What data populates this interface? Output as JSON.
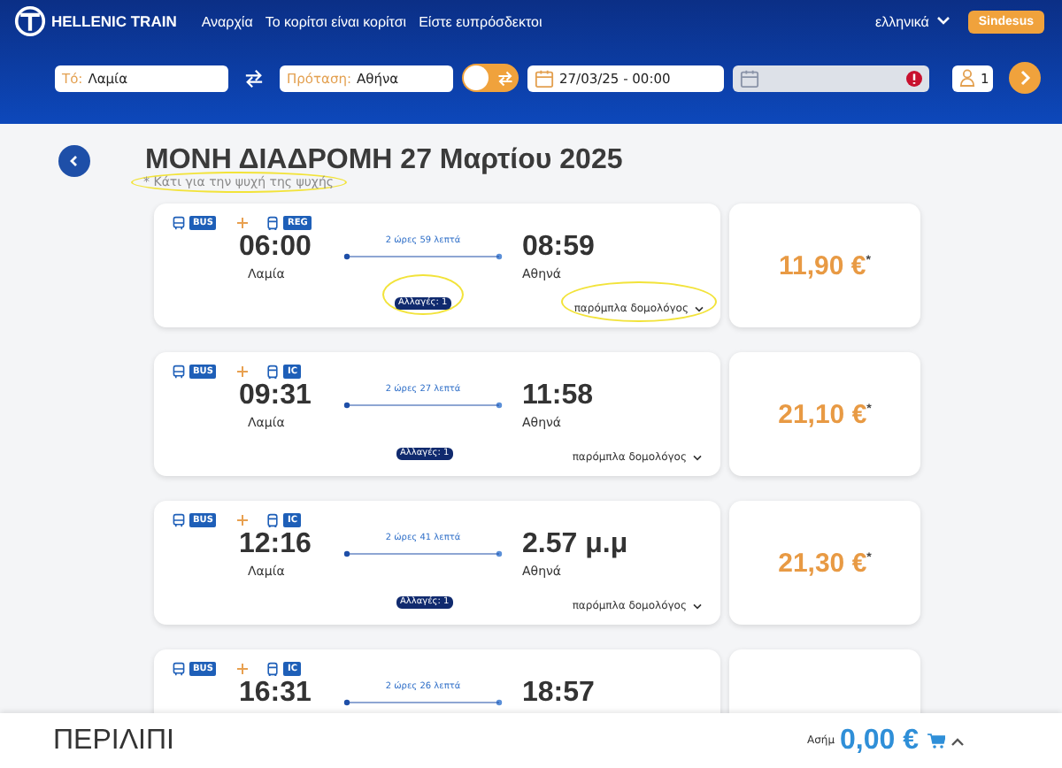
{
  "header": {
    "logo_text": "HELLENIC TRAIN",
    "nav": [
      "Αναρχία",
      "Το κορίτσι είναι κορίτσι",
      "Είστε ευπρόσδεκτοι"
    ],
    "language": "ελληνικά",
    "login_button": "Sindesus"
  },
  "search": {
    "from": {
      "label": "Τό:",
      "value": "Λαμία"
    },
    "to": {
      "label": "Πρόταση:",
      "value": "Αθήνα"
    },
    "round_trip_toggle": {
      "on": false
    },
    "date": {
      "value": "27/03/25 - 00:00"
    },
    "return_date": {
      "disabled": true,
      "error": true
    },
    "passengers": {
      "value": "1"
    }
  },
  "title": "ΜΟΝΗ ΔΙΑΔΡΟΜΗ 27 Μαρτίου 2025",
  "note": {
    "text": "* Κάτι για την ψυχή της ψυχής",
    "highlighted": true
  },
  "journeys": [
    {
      "legs": [
        "BUS",
        "REG"
      ],
      "depart": "06:00",
      "from": "Λαμία",
      "duration": "2 ώρες 59 λεπτά",
      "arrive": "08:59",
      "to": "Αθηνά",
      "changes": "Αλλαγές: 1",
      "changes_highlighted": true,
      "other_schedules": "παρόμπλα δομολόγος",
      "other_highlighted": true,
      "price": "11,90 €$^{*}$"
    },
    {
      "legs": [
        "BUS",
        "IC"
      ],
      "depart": "09:31",
      "from": "Λαμία",
      "duration": "2 ώρες 27 λεπτά",
      "arrive": "11:58",
      "to": "Αθηνά",
      "changes": "Αλλαγές: 1",
      "changes_highlighted": false,
      "other_schedules": "παρόμπλα δομολόγος",
      "other_highlighted": false,
      "price": "21,10 €$^{*}$"
    },
    {
      "legs": [
        "BUS",
        "IC"
      ],
      "depart": "12:16",
      "from": "Λαμία",
      "duration": "2 ώρες 41 λεπτά",
      "arrive": "2.57 μ.μ",
      "to": "Αθηνά",
      "changes": "Αλλαγές: 1",
      "changes_highlighted": false,
      "other_schedules": "παρόμπλα δομολόγος",
      "other_highlighted": false,
      "price": "21,30 €$^{*}$"
    },
    {
      "legs": [
        "BUS",
        "IC"
      ],
      "depart": "16:31",
      "duration": "2 ώρες 26 λεπτά",
      "arrive": "18:57"
    }
  ],
  "summary": {
    "title": "ΠΕΡΙΛΙΠΙ",
    "label": "Ασήμ",
    "total": "0,00 €"
  }
}
